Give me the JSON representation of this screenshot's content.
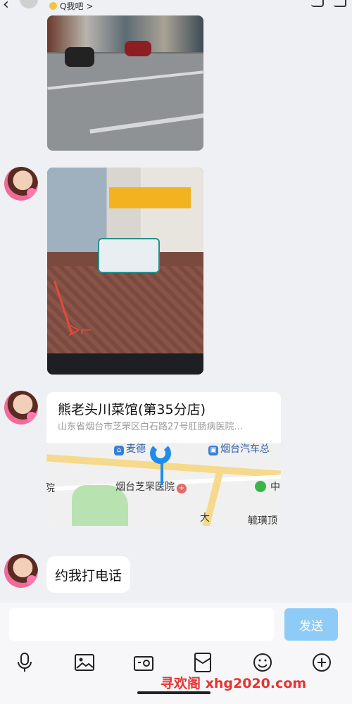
{
  "header": {
    "subtitle": "Q我吧",
    "chevron": ">"
  },
  "messages": {
    "location": {
      "title": "熊老头川菜馆(第35分店)",
      "address": "山东省烟台市芝罘区白石路27号肛肠病医院...",
      "map_labels": {
        "poi1": "麦德",
        "poi2": "烟台汽车总",
        "hospital": "烟台芝罘医院",
        "hospital_icon": "+",
        "left_fragment": "院",
        "right_fragment": "中",
        "bottom_left": "大",
        "bottom_right": "毓璜顶"
      }
    },
    "text_bubble": "约我打电话"
  },
  "composer": {
    "input_value": "",
    "send_label": "发送"
  },
  "toolbar_icons": [
    "microphone-icon",
    "image-icon",
    "camera-icon",
    "red-packet-icon",
    "emoji-icon",
    "plus-icon"
  ],
  "watermark": "寻欢阁 xhg2020.com",
  "colors": {
    "accent": "#1f8cec",
    "send_button": "#8ecbf7",
    "watermark": "#e8322f",
    "background": "#eef0f4"
  }
}
